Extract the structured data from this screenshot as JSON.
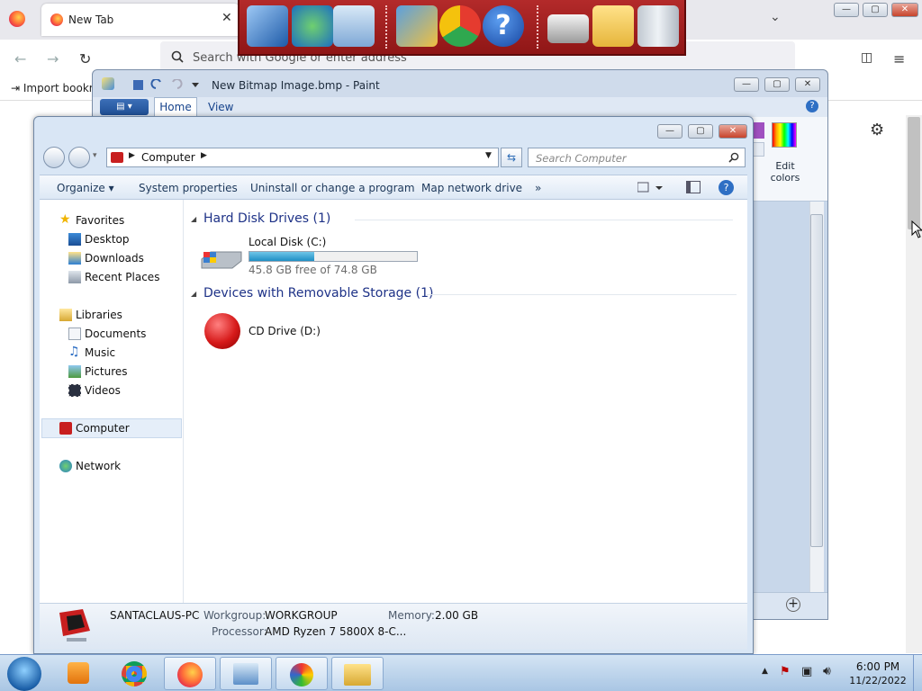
{
  "firefox": {
    "tab_title": "New Tab",
    "tab_close": "✕",
    "url_placeholder": "Search with Google or enter address",
    "bookmark_import": "Import bookm",
    "back": "←",
    "forward": "→",
    "reload": "↻",
    "tabs_list": "⌄",
    "menu": "≡",
    "pocket": "◫",
    "gear": "⚙"
  },
  "paint": {
    "title": "New Bitmap Image.bmp - Paint",
    "tabs": [
      "Home",
      "View"
    ],
    "edit_colors": "Edit colors",
    "menu_btn": "▤ ▾",
    "help": "?",
    "zoom_plus": "+"
  },
  "explorer": {
    "address": "Computer",
    "search_placeholder": "Search Computer",
    "commands": [
      "Organize ▾",
      "System properties",
      "Uninstall or change a program",
      "Map network drive",
      "»"
    ],
    "nav": {
      "favorites": "Favorites",
      "desktop": "Desktop",
      "downloads": "Downloads",
      "recent": "Recent Places",
      "libraries": "Libraries",
      "documents": "Documents",
      "music": "Music",
      "pictures": "Pictures",
      "videos": "Videos",
      "computer": "Computer",
      "network": "Network"
    },
    "groups": {
      "hdd": "Hard Disk Drives (1)",
      "removable": "Devices with Removable Storage (1)"
    },
    "drives": {
      "c_name": "Local Disk (C:)",
      "c_free": "45.8 GB free of 74.8 GB",
      "c_used_fraction": 0.388,
      "d_name": "CD Drive (D:)"
    },
    "details": {
      "pc_name": "SANTACLAUS-PC",
      "workgroup_label": "Workgroup:",
      "workgroup": "WORKGROUP",
      "memory_label": "Memory:",
      "memory": "2.00 GB",
      "processor_label": "Processor:",
      "processor": "AMD Ryzen 7 5800X 8-C..."
    }
  },
  "taskbar": {
    "time": "6:00 PM",
    "date": "11/22/2022"
  },
  "window_controls": {
    "min": "—",
    "max": "▢",
    "close": "✕"
  }
}
